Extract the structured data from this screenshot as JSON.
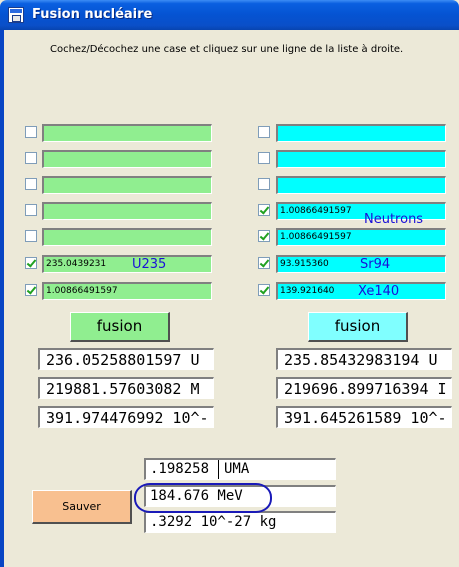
{
  "window": {
    "title": "Fusion nucléaire"
  },
  "instruction": "Cochez/Décochez une case et cliquez sur une ligne de la liste à droite.",
  "left_rows": [
    {
      "checked": false,
      "value": "",
      "name": ""
    },
    {
      "checked": false,
      "value": "",
      "name": ""
    },
    {
      "checked": false,
      "value": "",
      "name": ""
    },
    {
      "checked": false,
      "value": "",
      "name": ""
    },
    {
      "checked": false,
      "value": "",
      "name": ""
    },
    {
      "checked": true,
      "value": "235.0439231",
      "name": "U235"
    },
    {
      "checked": true,
      "value": "1.00866491597",
      "name": ""
    }
  ],
  "right_rows": [
    {
      "checked": false,
      "value": "",
      "name": ""
    },
    {
      "checked": false,
      "value": "",
      "name": ""
    },
    {
      "checked": false,
      "value": "",
      "name": ""
    },
    {
      "checked": true,
      "value": "1.00866491597",
      "name": "Neutrons"
    },
    {
      "checked": true,
      "value": "1.00866491597",
      "name": ""
    },
    {
      "checked": true,
      "value": "93.915360",
      "name": "Sr94"
    },
    {
      "checked": true,
      "value": "139.921640",
      "name": "Xe140"
    }
  ],
  "buttons": {
    "fusion_left": "fusion",
    "fusion_right": "fusion",
    "save": "Sauver"
  },
  "left_outputs": [
    "236.05258801597 U",
    "219881.57603082 M",
    "391.974476992 10^-"
  ],
  "right_outputs": [
    "235.85432983194 U",
    "219696.899716394 I",
    "391.645261589 10^-"
  ],
  "results": [
    {
      "value": ".198258",
      "unit": "UMA"
    },
    {
      "value": "184.676 MeV",
      "unit": ""
    },
    {
      "value": ".3292 10^-27 kg",
      "unit": ""
    }
  ],
  "colors": {
    "green": "#90ee90",
    "cyan": "#00ffff",
    "orange": "#f8c090",
    "label_blue": "#1a10d8"
  }
}
